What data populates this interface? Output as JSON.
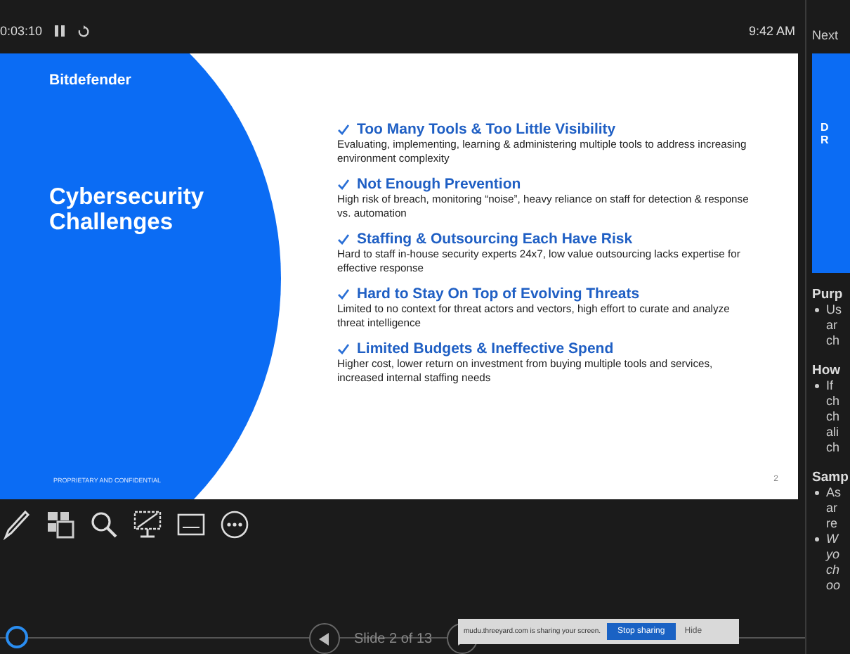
{
  "top_bar": {
    "timer": "0:03:10",
    "clock": "9:42 AM"
  },
  "slide": {
    "brand": "Bitdefender",
    "title": "Cybersecurity Challenges",
    "footer": "PROPRIETARY AND CONFIDENTIAL",
    "page": "2",
    "points": [
      {
        "heading": "Too Many Tools & Too Little Visibility",
        "text": "Evaluating, implementing, learning & administering multiple tools to address increasing environment complexity"
      },
      {
        "heading": "Not Enough Prevention",
        "text": "High risk of breach, monitoring “noise”, heavy reliance on staff for detection & response vs. automation"
      },
      {
        "heading": "Staffing & Outsourcing Each Have Risk",
        "text": "Hard to staff in-house security experts 24x7, low value outsourcing lacks expertise for effective response"
      },
      {
        "heading": "Hard to Stay On Top of Evolving Threats",
        "text": "Limited to no context for threat actors and vectors, high effort to curate and analyze threat intelligence"
      },
      {
        "heading": "Limited Budgets & Ineffective Spend",
        "text": "Higher cost, lower return on investment from buying multiple tools and services, increased internal staffing needs"
      }
    ]
  },
  "notes_panel": {
    "label": "Next",
    "thumbnail_lines": [
      "D",
      "R"
    ],
    "sections": [
      {
        "heading": "Purp",
        "lines": [
          {
            "text": "Us",
            "bullet": true,
            "italic": false
          },
          {
            "text": "ar",
            "bullet": false,
            "italic": false
          },
          {
            "text": "ch",
            "bullet": false,
            "italic": false
          }
        ]
      },
      {
        "heading": "How",
        "lines": [
          {
            "text": "If",
            "bullet": true,
            "italic": false
          },
          {
            "text": "ch",
            "bullet": false,
            "italic": false
          },
          {
            "text": "ch",
            "bullet": false,
            "italic": false
          },
          {
            "text": "ali",
            "bullet": false,
            "italic": false
          },
          {
            "text": "ch",
            "bullet": false,
            "italic": false
          }
        ]
      },
      {
        "heading": "Samp",
        "lines": [
          {
            "text": "As",
            "bullet": true,
            "italic": false
          },
          {
            "text": "ar",
            "bullet": false,
            "italic": false
          },
          {
            "text": "re",
            "bullet": false,
            "italic": false
          },
          {
            "text": "W",
            "bullet": true,
            "italic": true
          },
          {
            "text": "yo",
            "bullet": false,
            "italic": true
          },
          {
            "text": "ch",
            "bullet": false,
            "italic": true
          },
          {
            "text": "oo",
            "bullet": false,
            "italic": true
          }
        ]
      }
    ]
  },
  "bottom_bar": {
    "slide_counter": "Slide 2 of 13",
    "progress": {
      "level": 0.0
    }
  },
  "share_notice": {
    "message": "mudu.threeyard.com is sharing your screen.",
    "stop_button": "Stop sharing",
    "hide_button": "Hide"
  }
}
